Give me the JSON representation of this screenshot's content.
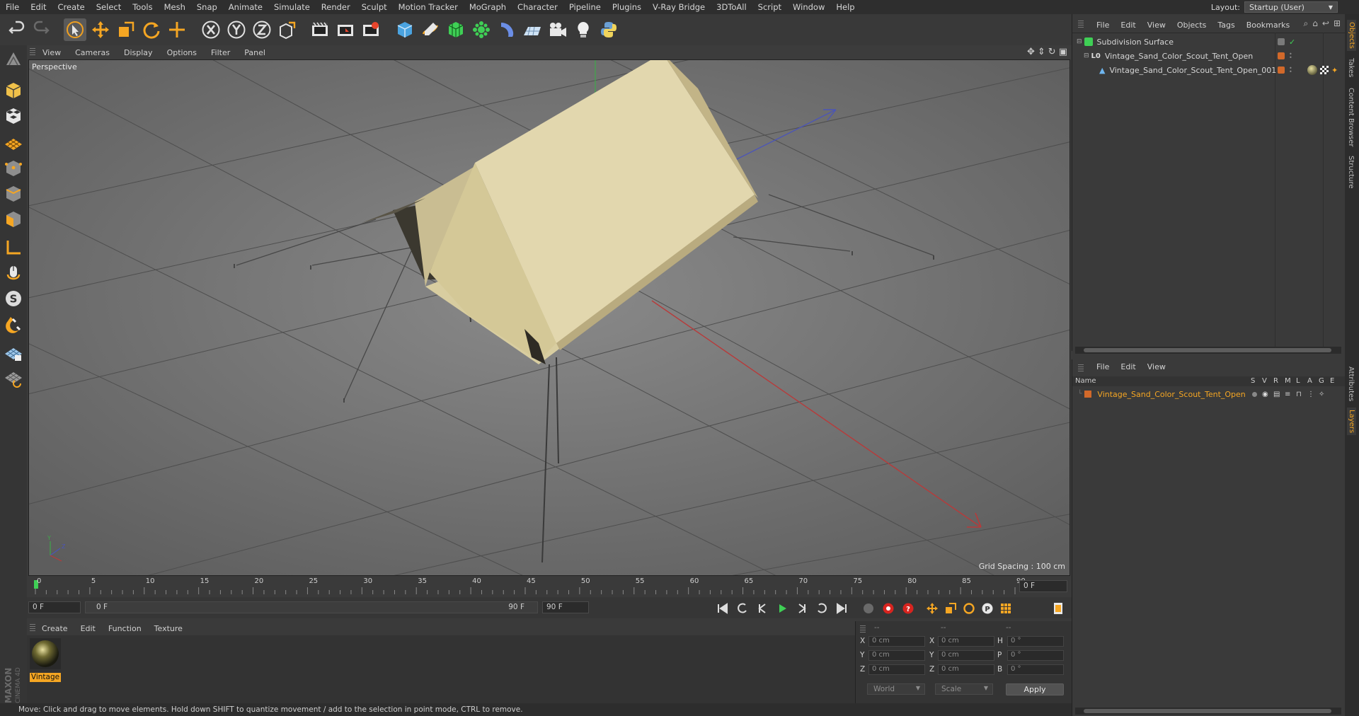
{
  "menubar": {
    "items": [
      "File",
      "Edit",
      "Create",
      "Select",
      "Tools",
      "Mesh",
      "Snap",
      "Animate",
      "Simulate",
      "Render",
      "Sculpt",
      "Motion Tracker",
      "MoGraph",
      "Character",
      "Pipeline",
      "Plugins",
      "V-Ray Bridge",
      "3DToAll",
      "Script",
      "Window",
      "Help"
    ],
    "layout_label": "Layout:",
    "layout_value": "Startup (User)"
  },
  "toolbar": {
    "icons": [
      "undo-icon",
      "redo-icon",
      "live-selection-icon",
      "move-icon",
      "scale-icon",
      "rotate-icon",
      "add-object-icon",
      "x-axis-icon",
      "y-axis-icon",
      "z-axis-icon",
      "coordinate-system-icon",
      "render-view-icon",
      "render-picture-viewer-icon",
      "edit-render-settings-icon",
      "cube-icon",
      "pen-icon",
      "subdivision-icon",
      "array-icon",
      "deformer-icon",
      "floor-icon",
      "camera-icon",
      "light-icon",
      "python-icon"
    ]
  },
  "viewport": {
    "menu": [
      "View",
      "Cameras",
      "Display",
      "Options",
      "Filter",
      "Panel"
    ],
    "label": "Perspective",
    "grid_spacing": "Grid Spacing : 100 cm"
  },
  "timeline": {
    "ticks": [
      "0",
      "5",
      "10",
      "15",
      "20",
      "25",
      "30",
      "35",
      "40",
      "45",
      "50",
      "55",
      "60",
      "65",
      "70",
      "75",
      "80",
      "85",
      "90"
    ],
    "current_frame": "0 F",
    "start_field": "0 F",
    "range_start": "0 F",
    "range_end": "90 F",
    "end_field": "90 F"
  },
  "material_manager": {
    "menu": [
      "Create",
      "Edit",
      "Function",
      "Texture"
    ],
    "materials": [
      {
        "name": "Vintage"
      }
    ]
  },
  "coordinates": {
    "header": [
      "--",
      "--",
      "--"
    ],
    "rows": [
      {
        "axis": "X",
        "pos": "0 cm",
        "axis2": "X",
        "size": "0 cm",
        "rot_label": "H",
        "rot": "0 °"
      },
      {
        "axis": "Y",
        "pos": "0 cm",
        "axis2": "Y",
        "size": "0 cm",
        "rot_label": "P",
        "rot": "0 °"
      },
      {
        "axis": "Z",
        "pos": "0 cm",
        "axis2": "Z",
        "size": "0 cm",
        "rot_label": "B",
        "rot": "0 °"
      }
    ],
    "mode_select": "World",
    "scale_select": "Scale",
    "apply_label": "Apply"
  },
  "status": "Move: Click and drag to move elements. Hold down SHIFT to quantize movement / add to the selection in point mode, CTRL to remove.",
  "object_manager": {
    "menu": [
      "File",
      "Edit",
      "View",
      "Objects",
      "Tags",
      "Bookmarks"
    ],
    "objects": [
      {
        "name": "Subdivision Surface"
      },
      {
        "name": "Vintage_Sand_Color_Scout_Tent_Open"
      },
      {
        "name": "Vintage_Sand_Color_Scout_Tent_Open_001"
      }
    ]
  },
  "layer_manager": {
    "menu": [
      "File",
      "Edit",
      "View"
    ],
    "columns": [
      "Name",
      "S",
      "V",
      "R",
      "M",
      "L",
      "A",
      "G",
      "E"
    ],
    "layers": [
      {
        "name": "Vintage_Sand_Color_Scout_Tent_Open",
        "color": "#d2692a"
      }
    ]
  },
  "side_tabs": [
    "Objects",
    "Takes",
    "Content Browser",
    "Structure",
    "Attributes",
    "Layers"
  ],
  "brand": {
    "maxon": "MAXON",
    "cinema": "CINEMA 4D"
  },
  "colors": {
    "accent": "#f5a623",
    "layer_orange": "#d2692a",
    "play_green": "#3fcf55",
    "record_red": "#d8241f"
  }
}
